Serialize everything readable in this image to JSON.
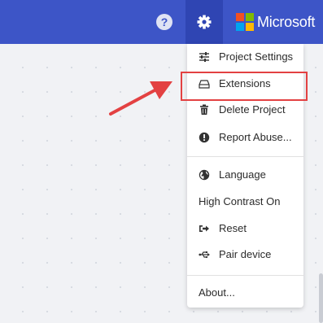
{
  "topbar": {
    "help_icon": "help-circle-icon",
    "help_glyph": "?",
    "settings_icon": "gear-icon",
    "brand": "Microsoft",
    "colors": {
      "bar": "#3d55c7",
      "settings_active": "#2f45b3",
      "logo_red": "#f25022",
      "logo_green": "#7fba00",
      "logo_blue": "#00a4ef",
      "logo_yellow": "#ffb900"
    }
  },
  "menu": {
    "items": [
      {
        "label": "Project Settings",
        "icon": "sliders-icon"
      },
      {
        "label": "Extensions",
        "icon": "drive-icon"
      },
      {
        "label": "Delete Project",
        "icon": "trash-icon"
      },
      {
        "label": "Report Abuse...",
        "icon": "exclamation-circle-icon"
      },
      {
        "label": "Language",
        "icon": "globe-icon"
      },
      {
        "label": "High Contrast On",
        "icon": ""
      },
      {
        "label": "Reset",
        "icon": "sign-out-icon"
      },
      {
        "label": "Pair device",
        "icon": "usb-icon"
      },
      {
        "label": "About...",
        "icon": ""
      }
    ]
  },
  "annotation": {
    "color": "#e34142"
  }
}
